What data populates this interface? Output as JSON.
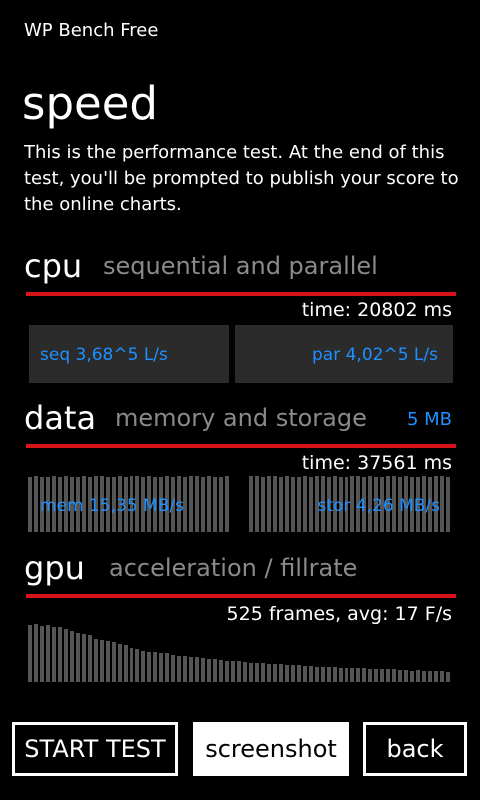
{
  "app": {
    "title": "WP Bench Free",
    "page_title": "speed",
    "description": "This is the performance test. At the end of this test, you'll be prompted to publish your score to the online charts."
  },
  "cpu": {
    "name": "cpu",
    "subtitle": "sequential and parallel",
    "time": "time: 20802 ms",
    "seq": "seq 3,68^5 L/s",
    "par": "par 4,02^5 L/s"
  },
  "data": {
    "name": "data",
    "subtitle": "memory and storage",
    "size": "5 MB",
    "time": "time: 37561 ms",
    "mem": "mem 15,35 MB/s",
    "stor": "stor 4,26 MB/s",
    "bar_levels": [
      0.95,
      0.96,
      0.94,
      0.95,
      0.97,
      0.95,
      0.96,
      0.94,
      0.95,
      0.96,
      0.95,
      0.97,
      0.96,
      0.95,
      0.94,
      0.96,
      0.95,
      0.96,
      0.97,
      0.95,
      0.96,
      0.95,
      0.94,
      0.96,
      0.95,
      0.96,
      0.95,
      0.97,
      0.96,
      0.95,
      0.96,
      0.94,
      0.95,
      0.96,
      0,
      0,
      0,
      0.97,
      0.96,
      0.95,
      0.96,
      0.97,
      0.95,
      0.96,
      0.95,
      0.94,
      0.96,
      0.95,
      0.97,
      0.96,
      0.95,
      0.96,
      0.94,
      0.95,
      0.97,
      0.96,
      0.95,
      0.96,
      0.94,
      0.95,
      0.96,
      0.97,
      0.95,
      0.96,
      0.95,
      0.94,
      0.96,
      0.95,
      0.96,
      0.97,
      0.95
    ]
  },
  "gpu": {
    "name": "gpu",
    "subtitle": "acceleration / fillrate",
    "stats": "525 frames, avg: 17 F/s",
    "bar_levels": [
      1.0,
      1.02,
      0.98,
      1.0,
      0.96,
      0.97,
      0.93,
      0.9,
      0.86,
      0.84,
      0.82,
      0.76,
      0.74,
      0.72,
      0.7,
      0.66,
      0.64,
      0.6,
      0.58,
      0.55,
      0.53,
      0.52,
      0.5,
      0.5,
      0.47,
      0.46,
      0.45,
      0.44,
      0.44,
      0.42,
      0.4,
      0.41,
      0.38,
      0.37,
      0.36,
      0.36,
      0.35,
      0.34,
      0.33,
      0.33,
      0.32,
      0.31,
      0.31,
      0.3,
      0.29,
      0.3,
      0.28,
      0.28,
      0.27,
      0.27,
      0.26,
      0.26,
      0.25,
      0.25,
      0.24,
      0.24,
      0.24,
      0.23,
      0.23,
      0.22,
      0.23,
      0.22,
      0.21,
      0.21,
      0.2,
      0.21,
      0.2,
      0.2,
      0.19,
      0.19,
      0.18
    ]
  },
  "buttons": {
    "start": "START TEST",
    "screenshot": "screenshot",
    "back": "back"
  },
  "colors": {
    "accent": "#1e90ff",
    "divider": "#d8141b",
    "bar": "#555555",
    "box": "#2b2b2b"
  }
}
